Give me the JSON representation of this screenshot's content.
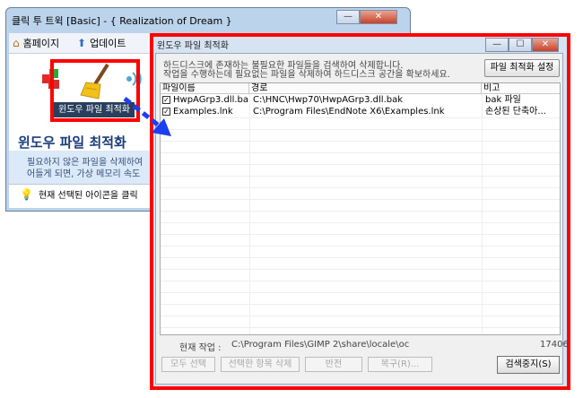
{
  "back_window": {
    "title": "클릭 투 트윅 [Basic] - { Realization of Dream }",
    "toolbar": {
      "home": "홈페이지",
      "update": "업데이트"
    },
    "icon_label": "윈도우 파일 최적화",
    "heading": "윈도우 파일 최적화",
    "desc_line1": "필요하지 않은 파일을 삭제하여",
    "desc_line2": "어들게 되면, 가상 메모리 속도",
    "hint": "현재 선택된 아이콘을 클릭"
  },
  "front_window": {
    "title": "윈도우 파일 최적화",
    "info_line1": "하드디스크에 존재하는 불필요한 파일들을 검색하여 삭제합니다.",
    "info_line2": "작업을 수행하는데 필요없는 파일을 삭제하여 하드디스크 공간을 확보하세요.",
    "options_button": "파일 최적화 설정",
    "columns": [
      "파일이름",
      "경로",
      "비고"
    ],
    "rows": [
      {
        "name": "HwpAGrp3.dll.bak",
        "path": "C:\\HNC\\Hwp70\\HwpAGrp3.dll.bak",
        "note": "bak 파일",
        "checked": true
      },
      {
        "name": "Examples.lnk",
        "path": "C:\\Program Files\\EndNote X6\\Examples.lnk",
        "note": "손상된 단축아...",
        "checked": true
      }
    ],
    "current_label": "현재 작업 :",
    "current_path": "C:\\Program Files\\GIMP 2\\share\\locale\\oc",
    "count": "17406",
    "buttons": {
      "select_all": "모두 선택",
      "delete_selected": "선택한 항목 삭제",
      "invert": "반전",
      "restore": "복구(R)...",
      "stop": "검색중지(S)"
    }
  },
  "colors": {
    "highlight": "#ff0000",
    "arrow": "#1e3ff0"
  }
}
